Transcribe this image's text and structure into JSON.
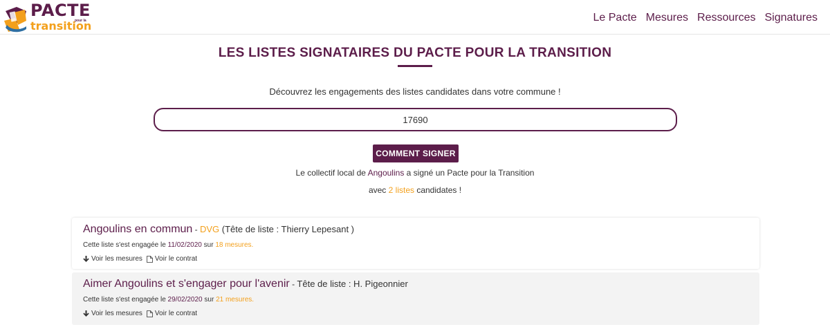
{
  "brand": {
    "word1": "PACTE",
    "word2": "transition",
    "small": "pour la",
    "colors": {
      "primary": "#5c1d4a",
      "accent": "#f3a01c"
    }
  },
  "nav": [
    "Le Pacte",
    "Mesures",
    "Ressources",
    "Signatures"
  ],
  "title": "LES LISTES SIGNATAIRES DU PACTE POUR LA TRANSITION",
  "subtitle": "Découvrez les engagements des listes candidates dans votre commune !",
  "search": {
    "value": "17690"
  },
  "cta": "COMMENT SIGNER",
  "info": {
    "line1_prefix": "Le collectif local de ",
    "commune": "Angoulins",
    "line1_suffix": " a signé un Pacte pour la Transition",
    "line2_prefix": "avec ",
    "count": "2 listes",
    "line2_suffix": " candidates !"
  },
  "lists": [
    {
      "name": "Angoulins en commun",
      "sep": " - ",
      "party": "DVG",
      "head": " (Tête de liste : Thierry Lepesant )",
      "engaged_prefix": "Cette liste s'est engagée le ",
      "date": "11/02/2020",
      "engaged_mid": " sur ",
      "measures": "18 mesures.",
      "link_measures": "Voir les mesures",
      "link_contract": "Voir le contrat"
    },
    {
      "name": "Aimer Angoulins et s'engager pour l'avenir",
      "sep": " - ",
      "party": "",
      "head": "Tête de liste : H. Pigeonnier",
      "engaged_prefix": "Cette liste s'est engagée le ",
      "date": "29/02/2020",
      "engaged_mid": " sur ",
      "measures": "21 mesures.",
      "link_measures": "Voir les mesures",
      "link_contract": "Voir le contrat"
    }
  ],
  "icons": {
    "measures": "arrow-down-icon",
    "contract": "document-icon"
  }
}
